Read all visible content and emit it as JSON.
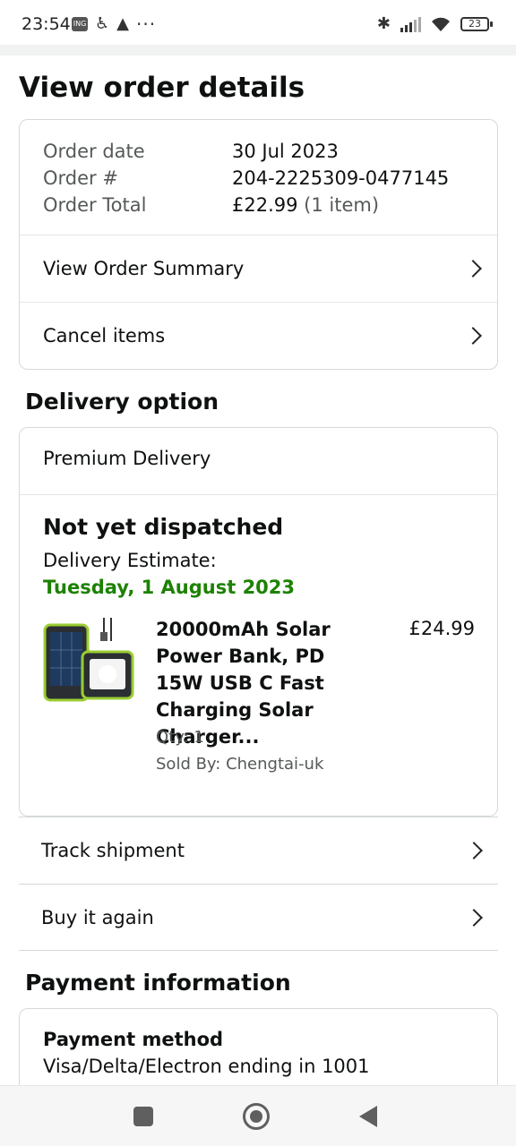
{
  "status_bar": {
    "time": "23:54",
    "notif_badge": "ING",
    "dots": "···",
    "battery": "23"
  },
  "page": {
    "title": "View order details"
  },
  "order": {
    "rows": [
      {
        "label": "Order date",
        "value": "30 Jul 2023",
        "extra": ""
      },
      {
        "label": "Order #",
        "value": "204-2225309-0477145",
        "extra": ""
      },
      {
        "label": "Order Total",
        "value": "£22.99",
        "extra": "(1 item)"
      }
    ],
    "summary_link": "View Order Summary",
    "cancel_link": "Cancel items"
  },
  "delivery": {
    "section_title": "Delivery option",
    "type": "Premium Delivery",
    "status": "Not yet dispatched",
    "estimate_label": "Delivery Estimate:",
    "estimate_date": "Tuesday, 1 August 2023",
    "estimate_color": "#1d8102",
    "product": {
      "title": "20000mAh Solar Power Bank, PD 15W USB C Fast Charging Solar Charger...",
      "price": "£24.99",
      "qty": "Qty: 1",
      "seller": "Sold By: Chengtai-uk"
    }
  },
  "actions": {
    "track": "Track shipment",
    "buy_again": "Buy it again"
  },
  "payment": {
    "section_title": "Payment information",
    "method_label": "Payment method",
    "method_value": "Visa/Delta/Electron  ending in 1001"
  },
  "nav": {
    "recents": "recents-button",
    "home": "home-button",
    "back": "back-button"
  }
}
